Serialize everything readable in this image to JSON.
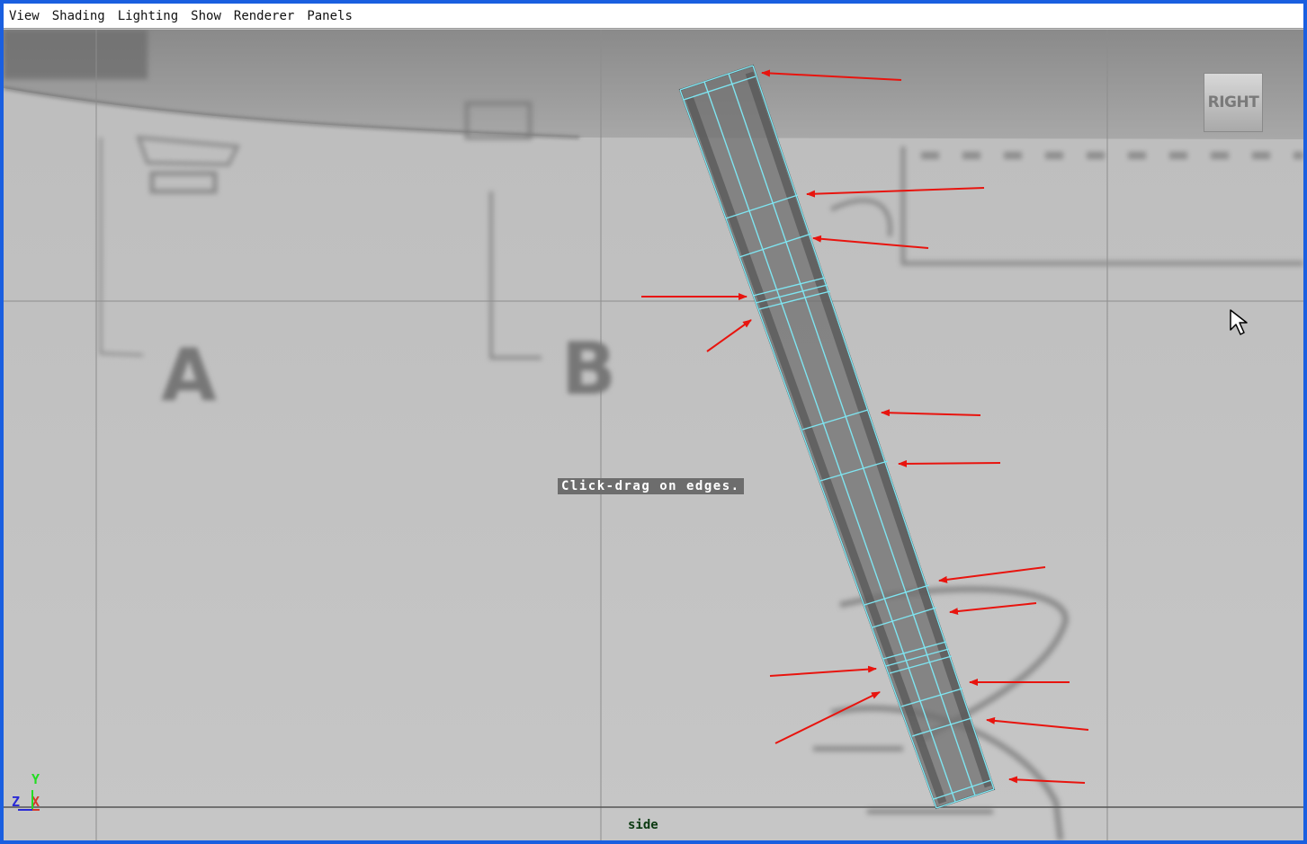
{
  "menubar": {
    "items": [
      "View",
      "Shading",
      "Lighting",
      "Show",
      "Renderer",
      "Panels"
    ]
  },
  "viewport": {
    "view_cube_label": "RIGHT",
    "help_line": "Click-drag on edges.",
    "camera_name": "side",
    "background_labels": [
      "A",
      "B"
    ],
    "axis_labels": {
      "y": "Y",
      "z": "Z",
      "x": "X"
    }
  },
  "colors": {
    "frame": "#1a5fe0",
    "wireframe": "#7fe4f0",
    "annotation_arrow": "#e8140e",
    "axis_y": "#22dd22",
    "axis_z": "#2a2ad6",
    "axis_x": "#d63a2a"
  },
  "icons": [
    "mouse-cursor-icon",
    "view-cube-icon",
    "axis-gizmo-icon",
    "red-arrow-icon"
  ]
}
